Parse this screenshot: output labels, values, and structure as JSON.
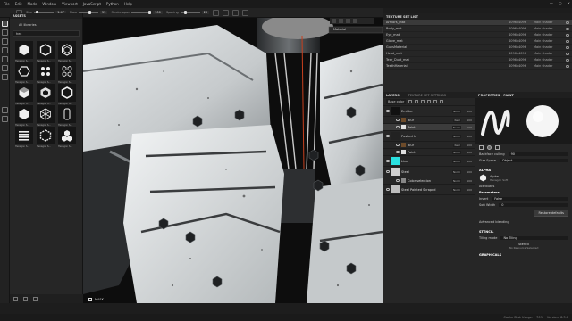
{
  "menu": [
    "File",
    "Edit",
    "Mode",
    "Window",
    "Viewport",
    "JavaScript",
    "Python",
    "Help"
  ],
  "window_controls": [
    "—",
    "▢",
    "✕"
  ],
  "toolbar": {
    "size_label": "Size",
    "size_value": "1.47",
    "flow_label": "Flow",
    "flow_value": "55",
    "stroke_label": "Stroke opac",
    "stroke_value": "100",
    "spacing_label": "Spacing",
    "spacing_value": "20"
  },
  "assets": {
    "title": "ASSETS",
    "library": "All libraries",
    "search_value": "hex",
    "tile_caption": "Hexagon S..."
  },
  "viewport": {
    "material_dropdown": "Material",
    "mask_label": "MASK"
  },
  "texture_set_list": {
    "title": "TEXTURE SET LIST",
    "rows": [
      {
        "name": "Armors_mat",
        "res": "4096x4096",
        "shader": "Main shader"
      },
      {
        "name": "Body_mat",
        "res": "4096x4096",
        "shader": "Main shader"
      },
      {
        "name": "Eye_mat",
        "res": "4096x4096",
        "shader": "Main shader"
      },
      {
        "name": "Glove_mat",
        "res": "4096x4096",
        "shader": "Main shader"
      },
      {
        "name": "GunsMaterial",
        "res": "4096x4096",
        "shader": "Main shader"
      },
      {
        "name": "Head_mat",
        "res": "4096x4096",
        "shader": "Main shader"
      },
      {
        "name": "Tear_Duct_mat",
        "res": "4096x4096",
        "shader": "Main shader"
      },
      {
        "name": "TeethMaterial",
        "res": "4096x4096",
        "shader": "Main shader"
      }
    ]
  },
  "layers": {
    "tab1": "LAYERS",
    "tab2": "TEXTURE SET SETTINGS",
    "blend": "Base color",
    "items": [
      {
        "name": "Emitter",
        "blend": "Norm",
        "opacity": "100",
        "sub": false
      },
      {
        "name": "Blur",
        "blend": "Repl",
        "opacity": "100",
        "sub": true
      },
      {
        "name": "Paint",
        "blend": "Norm",
        "opacity": "100",
        "sub": true
      },
      {
        "name": "Pushed In",
        "blend": "Norm",
        "opacity": "100",
        "sub": false
      },
      {
        "name": "Blur",
        "blend": "Repl",
        "opacity": "100",
        "sub": true
      },
      {
        "name": "Paint",
        "blend": "Norm",
        "opacity": "100",
        "sub": true
      },
      {
        "name": "Line",
        "blend": "Norm",
        "opacity": "100",
        "sub": false
      },
      {
        "name": "Steel",
        "blend": "Norm",
        "opacity": "100",
        "sub": false
      },
      {
        "name": "Color selection",
        "blend": "Norm",
        "opacity": "100",
        "sub": true
      },
      {
        "name": "Steel Painted Scraped",
        "blend": "Norm",
        "opacity": "100",
        "sub": false
      }
    ]
  },
  "properties": {
    "title": "PROPERTIES - PAINT",
    "backface_label": "Backface culling",
    "backface_value": "90",
    "size_space_label": "Size Space",
    "size_space_value": "Object",
    "alpha_section": "ALPHA",
    "alpha_name": "Alpha",
    "alpha_sub": "Hexagon Soft",
    "attributes": "Attributes",
    "parameters": "Parameters",
    "invert_label": "Invert",
    "invert_value": "False",
    "soft_width_label": "Soft Width",
    "soft_width_value": "0",
    "restore_button": "Restore defaults",
    "advanced": "Advanced blending",
    "stencil_section": "STENCIL",
    "tiling_label": "Tiling mode",
    "tiling_value": "No Tiling",
    "stencil_name": "Stencil",
    "stencil_sub": "No Resource Selected",
    "graphicals_section": "GRAPHICALS"
  },
  "status": {
    "cache": "Cache Disk Usage:",
    "cache_value": "70%",
    "version": "Version: 8.3.0"
  }
}
